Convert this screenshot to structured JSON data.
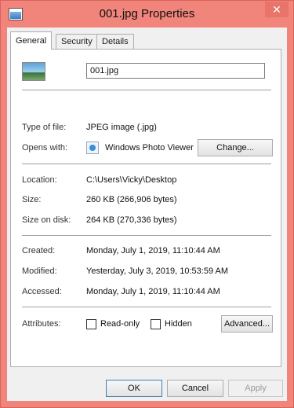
{
  "window": {
    "title": "001.jpg Properties",
    "close_glyph": "✕"
  },
  "tabs": [
    {
      "label": "General",
      "active": true
    },
    {
      "label": "Security",
      "active": false
    },
    {
      "label": "Details",
      "active": false
    }
  ],
  "general": {
    "file_name": "001.jpg",
    "type_label": "Type of file:",
    "type_value": "JPEG image (.jpg)",
    "opens_label": "Opens with:",
    "opens_value": "Windows Photo Viewer",
    "change_label": "Change...",
    "location_label": "Location:",
    "location_value": "C:\\Users\\Vicky\\Desktop",
    "size_label": "Size:",
    "size_value": "260 KB (266,906 bytes)",
    "size_on_disk_label": "Size on disk:",
    "size_on_disk_value": "264 KB (270,336 bytes)",
    "created_label": "Created:",
    "created_value": "Monday, July 1, 2019, 11:10:44 AM",
    "modified_label": "Modified:",
    "modified_value": "Yesterday, July 3, 2019, 10:53:59 AM",
    "accessed_label": "Accessed:",
    "accessed_value": "Monday, July 1, 2019, 11:10:44 AM",
    "attributes_label": "Attributes:",
    "readonly_label": "Read-only",
    "hidden_label": "Hidden",
    "advanced_label": "Advanced..."
  },
  "footer": {
    "ok": "OK",
    "cancel": "Cancel",
    "apply": "Apply"
  },
  "colors": {
    "titlebar": "#f1847b",
    "close_button": "#e8746a"
  }
}
